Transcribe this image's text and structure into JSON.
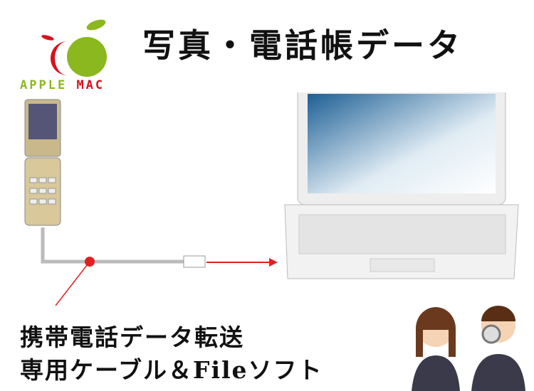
{
  "title": "写真・電話帳データ",
  "logo": {
    "text_a": "APPLE",
    "text_b": "MAC",
    "green": "#8ab81e",
    "red": "#d7121b"
  },
  "bottom": {
    "line1": "携帯電話データ転送",
    "line2": "専用ケーブル＆Fileソフト"
  }
}
